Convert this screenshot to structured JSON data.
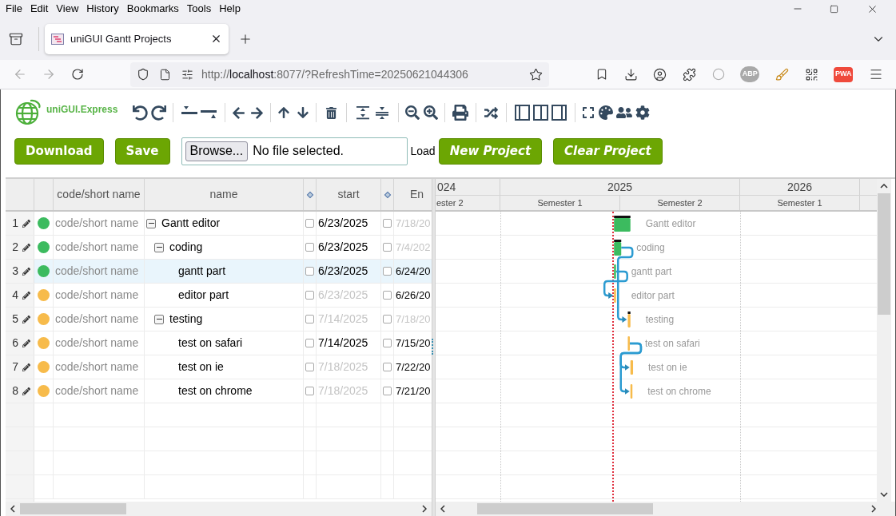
{
  "browser": {
    "menu": [
      "File",
      "Edit",
      "View",
      "History",
      "Bookmarks",
      "Tools",
      "Help"
    ],
    "tab": {
      "title": "uniGUI Gantt Projects"
    },
    "url": {
      "scheme": "http://",
      "host": "localhost",
      "rest": ":8077/?RefreshTime=20250621044306"
    },
    "badges": [
      {
        "kind": "abp",
        "text": "ABP"
      },
      {
        "kind": "pwa",
        "text": "PWA"
      }
    ]
  },
  "app": {
    "logo_text": "uniGUI.Express",
    "actions": [
      {
        "kind": "button",
        "label": "Download",
        "italic": false
      },
      {
        "kind": "button",
        "label": "Save",
        "italic": false
      },
      {
        "kind": "file",
        "button": "Browse...",
        "status": "No file selected."
      },
      {
        "kind": "label",
        "label": "Load"
      },
      {
        "kind": "button",
        "label": "New Project",
        "italic": true
      },
      {
        "kind": "button",
        "label": "Clear Project",
        "italic": true
      }
    ]
  },
  "grid": {
    "columns": [
      "code/short name",
      "name",
      "start",
      "En"
    ],
    "rows": [
      {
        "number": "1",
        "code": "code/short name",
        "name": "Gantt editor",
        "bar_label": "Gantt editor",
        "color": "#3cbb5f",
        "start": "6/23/2025",
        "start_dim": false,
        "start_checked": false,
        "end": "7/18/20",
        "end_dim": true,
        "end_checked": false,
        "selected": false,
        "expanded": true,
        "children": [
          {
            "number": "2",
            "code": "code/short name",
            "name": "coding",
            "bar_label": "coding",
            "color": "#3cbb5f",
            "start": "6/23/2025",
            "start_dim": false,
            "start_checked": false,
            "end": "7/4/202",
            "end_dim": true,
            "end_checked": false,
            "selected": false,
            "expanded": true,
            "children": [
              {
                "number": "3",
                "code": "code/short name",
                "name": "gantt part",
                "bar_label": "gantt part",
                "color": "#3cbb5f",
                "start": "6/23/2025",
                "start_dim": false,
                "start_checked": false,
                "end": "6/24/20",
                "end_dim": false,
                "end_checked": false,
                "selected": true
              },
              {
                "number": "4",
                "code": "code/short name",
                "name": "editor part",
                "bar_label": "editor part",
                "color": "#f7bb4b",
                "start": "6/23/2025",
                "start_dim": true,
                "start_checked": false,
                "end": "6/26/20",
                "end_dim": false,
                "end_checked": false,
                "selected": false
              }
            ]
          },
          {
            "number": "5",
            "code": "code/short name",
            "name": "testing",
            "bar_label": "testing",
            "color": "#f7bb4b",
            "start": "7/14/2025",
            "start_dim": true,
            "start_checked": false,
            "end": "7/18/20",
            "end_dim": true,
            "end_checked": false,
            "selected": false,
            "expanded": true,
            "children": [
              {
                "number": "6",
                "code": "code/short name",
                "name": "test on safari",
                "bar_label": "test on safari",
                "color": "#f7bb4b",
                "start": "7/14/2025",
                "start_dim": false,
                "start_checked": false,
                "end": "7/15/20",
                "end_dim": false,
                "end_checked": false,
                "selected": false
              },
              {
                "number": "7",
                "code": "code/short name",
                "name": "test on ie",
                "bar_label": "test on ie",
                "color": "#f7bb4b",
                "start": "7/18/2025",
                "start_dim": true,
                "start_checked": false,
                "end": "7/22/20",
                "end_dim": false,
                "end_checked": false,
                "selected": false
              },
              {
                "number": "8",
                "code": "code/short name",
                "name": "test on chrome",
                "bar_label": "test on chrome",
                "color": "#f7bb4b",
                "start": "7/18/2025",
                "start_dim": true,
                "start_checked": false,
                "end": "7/21/20",
                "end_dim": false,
                "end_checked": false,
                "selected": false
              }
            ]
          }
        ]
      }
    ]
  },
  "timeline": {
    "years": [
      "024",
      "2025",
      "2026"
    ],
    "semesters": [
      "ester 2",
      "Semester 1",
      "Semester 2",
      "Semester 1"
    ]
  }
}
